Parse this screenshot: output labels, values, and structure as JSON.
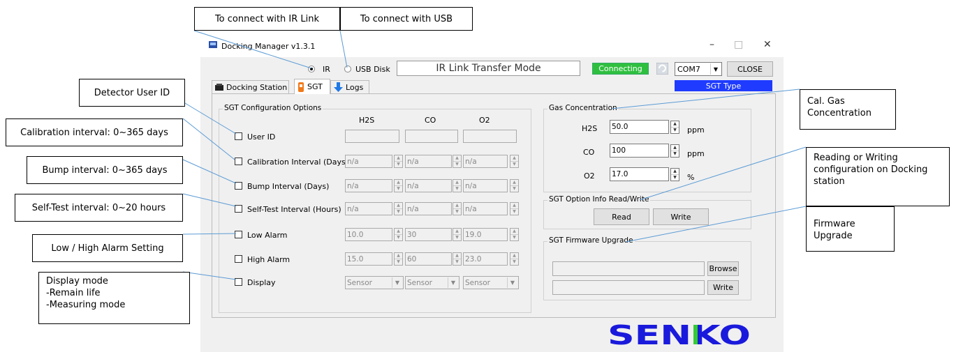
{
  "callouts": {
    "ir_link": "To connect with IR Link",
    "usb": "To connect with USB",
    "user_id": "Detector User ID",
    "calibration": "Calibration interval: 0~365 days",
    "bump": "Bump interval: 0~365 days",
    "selftest": "Self-Test interval: 0~20 hours",
    "alarm": "Low / High Alarm Setting",
    "display": "Display mode\n-Remain life\n-Measuring mode",
    "cal_gas": "Cal. Gas\nConcentration",
    "read_write": "Reading or Writing\nconfiguration on Docking\nstation",
    "firmware": "Firmware\nUpgrade"
  },
  "window": {
    "title": "Docking Manager v1.3.1",
    "minimize": "–",
    "maximize": "□",
    "close": "✕"
  },
  "toolbar": {
    "radio_ir": "IR",
    "radio_usb": "USB Disk",
    "mode_text": "IR Link Transfer Mode",
    "status": "Connecting",
    "com_port": "COM7",
    "close_button": "CLOSE",
    "sgt_type": "SGT Type",
    "ir_selected": true
  },
  "tabs": [
    {
      "label": "Docking Station",
      "icon": "docking-station-icon"
    },
    {
      "label": "SGT",
      "icon": "sgt-detector-icon",
      "active": true
    },
    {
      "label": "Logs",
      "icon": "arrow-down-icon"
    }
  ],
  "config": {
    "group_title": "SGT Configuration Options",
    "columns": [
      "H2S",
      "CO",
      "O2"
    ],
    "rows": [
      {
        "label": "User ID",
        "values": [
          "",
          "",
          ""
        ],
        "kind": "text"
      },
      {
        "label": "Calibration Interval (Days)",
        "values": [
          "n/a",
          "n/a",
          "n/a"
        ],
        "kind": "spin"
      },
      {
        "label": "Bump Interval (Days)",
        "values": [
          "n/a",
          "n/a",
          "n/a"
        ],
        "kind": "spin"
      },
      {
        "label": "Self-Test Interval (Hours)",
        "values": [
          "n/a",
          "n/a",
          "n/a"
        ],
        "kind": "spin"
      },
      {
        "label": "Low Alarm",
        "values": [
          "10.0",
          "30",
          "19.0"
        ],
        "kind": "spin"
      },
      {
        "label": "High Alarm",
        "values": [
          "15.0",
          "60",
          "23.0"
        ],
        "kind": "spin"
      },
      {
        "label": "Display",
        "values": [
          "Sensor",
          "Sensor",
          "Sensor"
        ],
        "kind": "select"
      }
    ]
  },
  "gas": {
    "group_title": "Gas Concentration",
    "rows": [
      {
        "label": "H2S",
        "value": "50.0",
        "unit": "ppm"
      },
      {
        "label": "CO",
        "value": "100",
        "unit": "ppm"
      },
      {
        "label": "O2",
        "value": "17.0",
        "unit": "%"
      }
    ]
  },
  "option_info": {
    "group_title": "SGT Option Info Read/Write",
    "read": "Read",
    "write": "Write"
  },
  "firmware": {
    "group_title": "SGT Firmware Upgrade",
    "browse": "Browse",
    "write": "Write"
  },
  "brand": {
    "logo_text": "SENKO",
    "colors": {
      "blue": "#1a1adc",
      "green": "#33cc33"
    }
  }
}
